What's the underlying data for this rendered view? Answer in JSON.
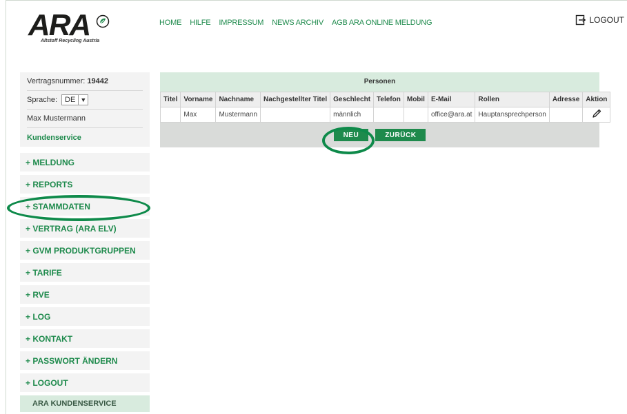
{
  "logo": {
    "title": "ARA",
    "subtitle": "Altstoff Recycling Austria"
  },
  "topnav": {
    "items": [
      "HOME",
      "HILFE",
      "IMPRESSUM",
      "NEWS ARCHIV",
      "AGB ARA ONLINE MELDUNG"
    ]
  },
  "header": {
    "logout_label": "LOGOUT"
  },
  "sidebar": {
    "contract_label": "Vertragsnummer:",
    "contract_number": "19442",
    "language_label": "Sprache:",
    "language_value": "DE",
    "user_name": "Max Mustermann",
    "customer_service": "Kundenservice",
    "menu": [
      "+ MELDUNG",
      "+ REPORTS",
      "+ STAMMDATEN",
      "+ VERTRAG (ARA ELV)",
      "+ GVM PRODUKTGRUPPEN",
      "+ TARIFE",
      "+ RVE",
      "+ LOG",
      "+ KONTAKT",
      "+ PASSWORT ÄNDERN",
      "+ LOGOUT"
    ],
    "bottom_box": "ARA KUNDENSERVICE"
  },
  "main": {
    "panel_title": "Personen",
    "columns": [
      "Titel",
      "Vorname",
      "Nachname",
      "Nachgestellter Titel",
      "Geschlecht",
      "Telefon",
      "Mobil",
      "E-Mail",
      "Rollen",
      "Adresse",
      "Aktion"
    ],
    "rows": [
      [
        "",
        "Max",
        "Mustermann",
        "",
        "männlich",
        "",
        "",
        "office@ara.at",
        "Hauptansprechperson",
        "",
        ""
      ]
    ],
    "btn_new": "NEU",
    "btn_back": "ZURÜCK"
  },
  "colors": {
    "accent": "#1e8a4c",
    "highlight": "#0e8a4a"
  },
  "icons": {
    "logo": "leaf-swirl-icon",
    "logout": "logout-icon",
    "edit": "pencil-icon"
  }
}
